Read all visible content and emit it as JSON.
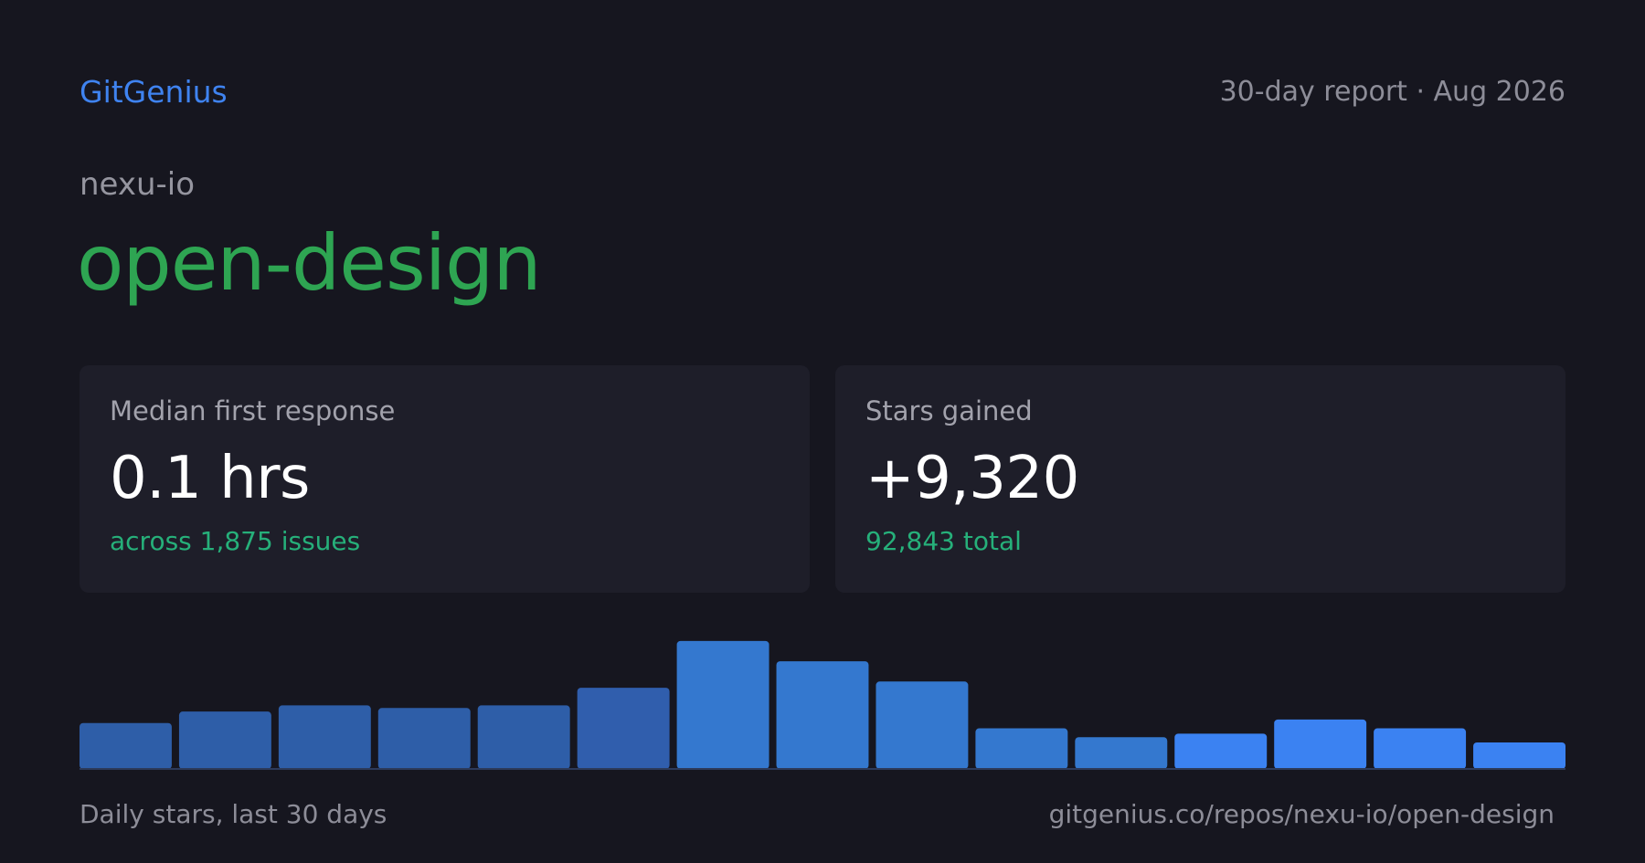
{
  "header": {
    "brand": "GitGenius",
    "report_label": "30-day report · Aug 2026"
  },
  "repo": {
    "owner": "nexu-io",
    "name": "open-design"
  },
  "cards": [
    {
      "label": "Median first response",
      "value": "0.1 hrs",
      "sub": "across 1,875 issues"
    },
    {
      "label": "Stars gained",
      "value": "+9,320",
      "sub": "92,843 total"
    }
  ],
  "footer": {
    "caption": "Daily stars, last 30 days",
    "url": "gitgenius.co/repos/nexu-io/open-design"
  },
  "colors": {
    "background": "#16161f",
    "card": "#1e1e29",
    "brand": "#3f83f0",
    "repo_name": "#2ea552",
    "accent_text": "#26b07a"
  },
  "chart_data": {
    "type": "bar",
    "values": [
      52,
      65,
      72,
      69,
      72,
      92,
      145,
      122,
      99,
      46,
      36,
      40,
      56,
      46,
      30
    ],
    "colors": [
      "#2e5ea8",
      "#2e5ea8",
      "#2e5ea8",
      "#2e5ea8",
      "#2e5ea8",
      "#305ead",
      "#3478cf",
      "#3478cf",
      "#3478cf",
      "#3478cf",
      "#3478cf",
      "#3b82f2",
      "#3b82f2",
      "#3b82f2",
      "#3b82f2"
    ],
    "ylim": [
      0,
      150
    ],
    "grid": false,
    "legend": "none",
    "title": "",
    "xlabel": "",
    "ylabel": ""
  }
}
